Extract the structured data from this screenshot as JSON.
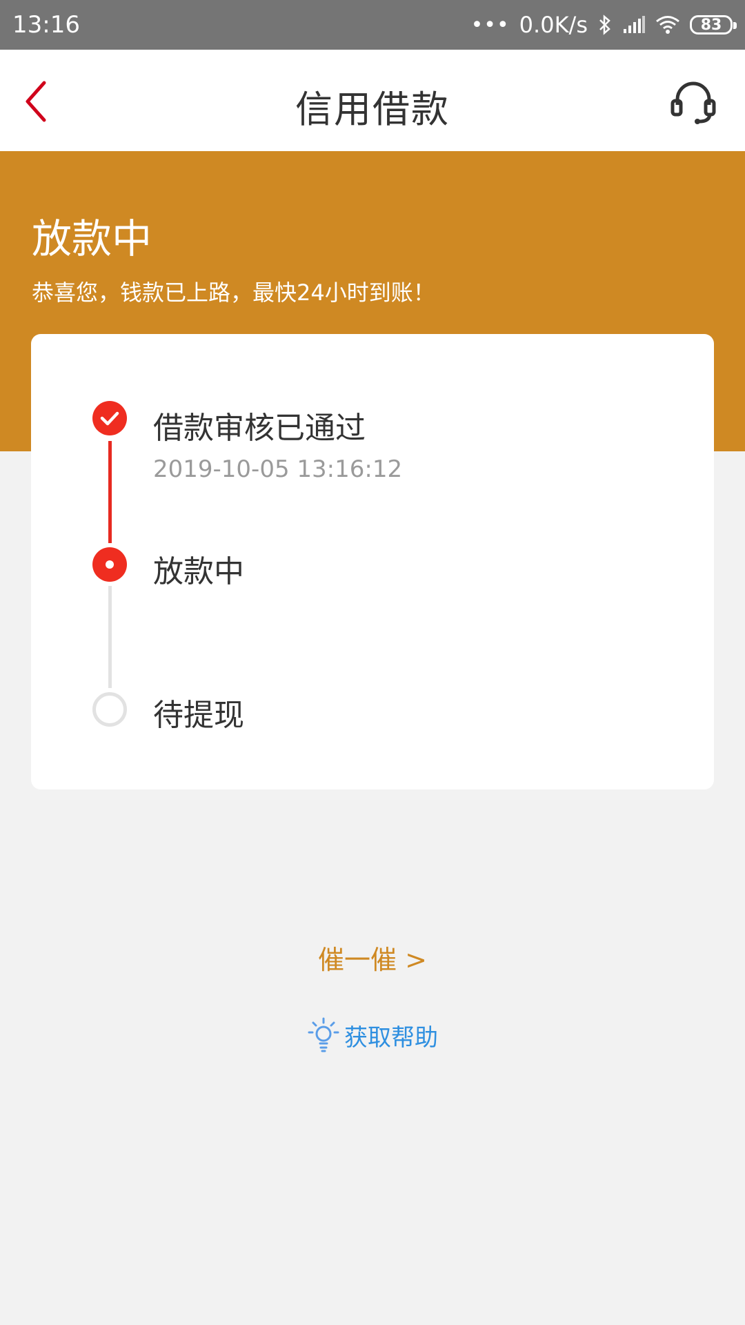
{
  "status_bar": {
    "time": "13:16",
    "network_speed": "0.0K/s",
    "battery": "83",
    "icons": [
      "dots-icon",
      "bluetooth-icon",
      "signal-icon",
      "wifi-icon",
      "battery-icon"
    ]
  },
  "nav": {
    "title": "信用借款",
    "back_icon": "chevron-left-icon",
    "service_icon": "headset-icon"
  },
  "hero": {
    "title": "放款中",
    "subtitle": "恭喜您，钱款已上路，最快24小时到账！"
  },
  "timeline": {
    "steps": [
      {
        "label": "借款审核已通过",
        "time": "2019-10-05 13:16:12",
        "state": "done"
      },
      {
        "label": "放款中",
        "time": "",
        "state": "current"
      },
      {
        "label": "待提现",
        "time": "",
        "state": "pending"
      }
    ]
  },
  "actions": {
    "urge_label": "催一催 >",
    "help_label": "获取帮助",
    "help_icon": "lightbulb-icon"
  },
  "colors": {
    "accent": "#cf8923",
    "progress_red": "#ef2d20",
    "help_blue": "#2e8fe0",
    "status_bar": "#757575"
  }
}
